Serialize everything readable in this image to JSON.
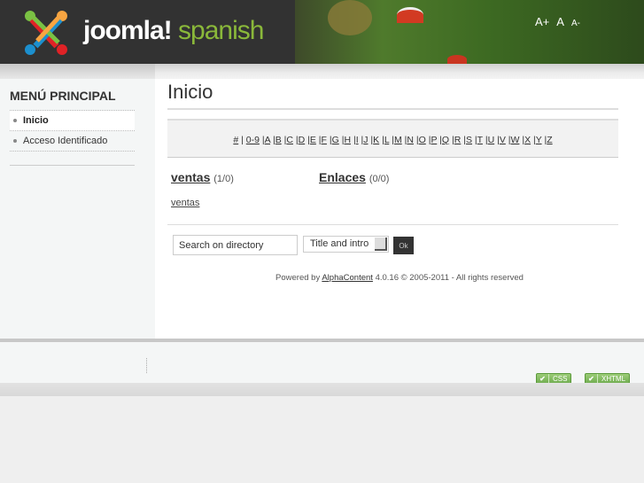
{
  "header": {
    "logo_main": "joomla!",
    "logo_sub": "spanish",
    "font_controls": [
      "A+",
      "A",
      "A-"
    ]
  },
  "sidebar": {
    "title": "MENÚ PRINCIPAL",
    "items": [
      {
        "label": "Inicio",
        "active": true
      },
      {
        "label": "Acceso Identificado"
      }
    ]
  },
  "main": {
    "title": "Inicio",
    "letters": [
      "#",
      "0-9",
      "A",
      "B",
      "C",
      "D",
      "E",
      "F",
      "G",
      "H",
      "I",
      "J",
      "K",
      "L",
      "M",
      "N",
      "O",
      "P",
      "Q",
      "R",
      "S",
      "T",
      "U",
      "V",
      "W",
      "X",
      "Y",
      "Z"
    ],
    "categories": [
      {
        "name": "ventas",
        "count": "(1/0)"
      },
      {
        "name": "Enlaces",
        "count": "(0/0)"
      }
    ],
    "subcategory": "ventas",
    "search": {
      "placeholder": "Search on directory",
      "select_value": "Title and intro",
      "ok_label": "Ok"
    },
    "powered": {
      "prefix": "Powered by",
      "link": "AlphaContent",
      "suffix": "4.0.16 © 2005-2011 - All rights reserved"
    }
  },
  "footer": {
    "badges": [
      "CSS",
      "XHTML"
    ],
    "check": "✔"
  }
}
